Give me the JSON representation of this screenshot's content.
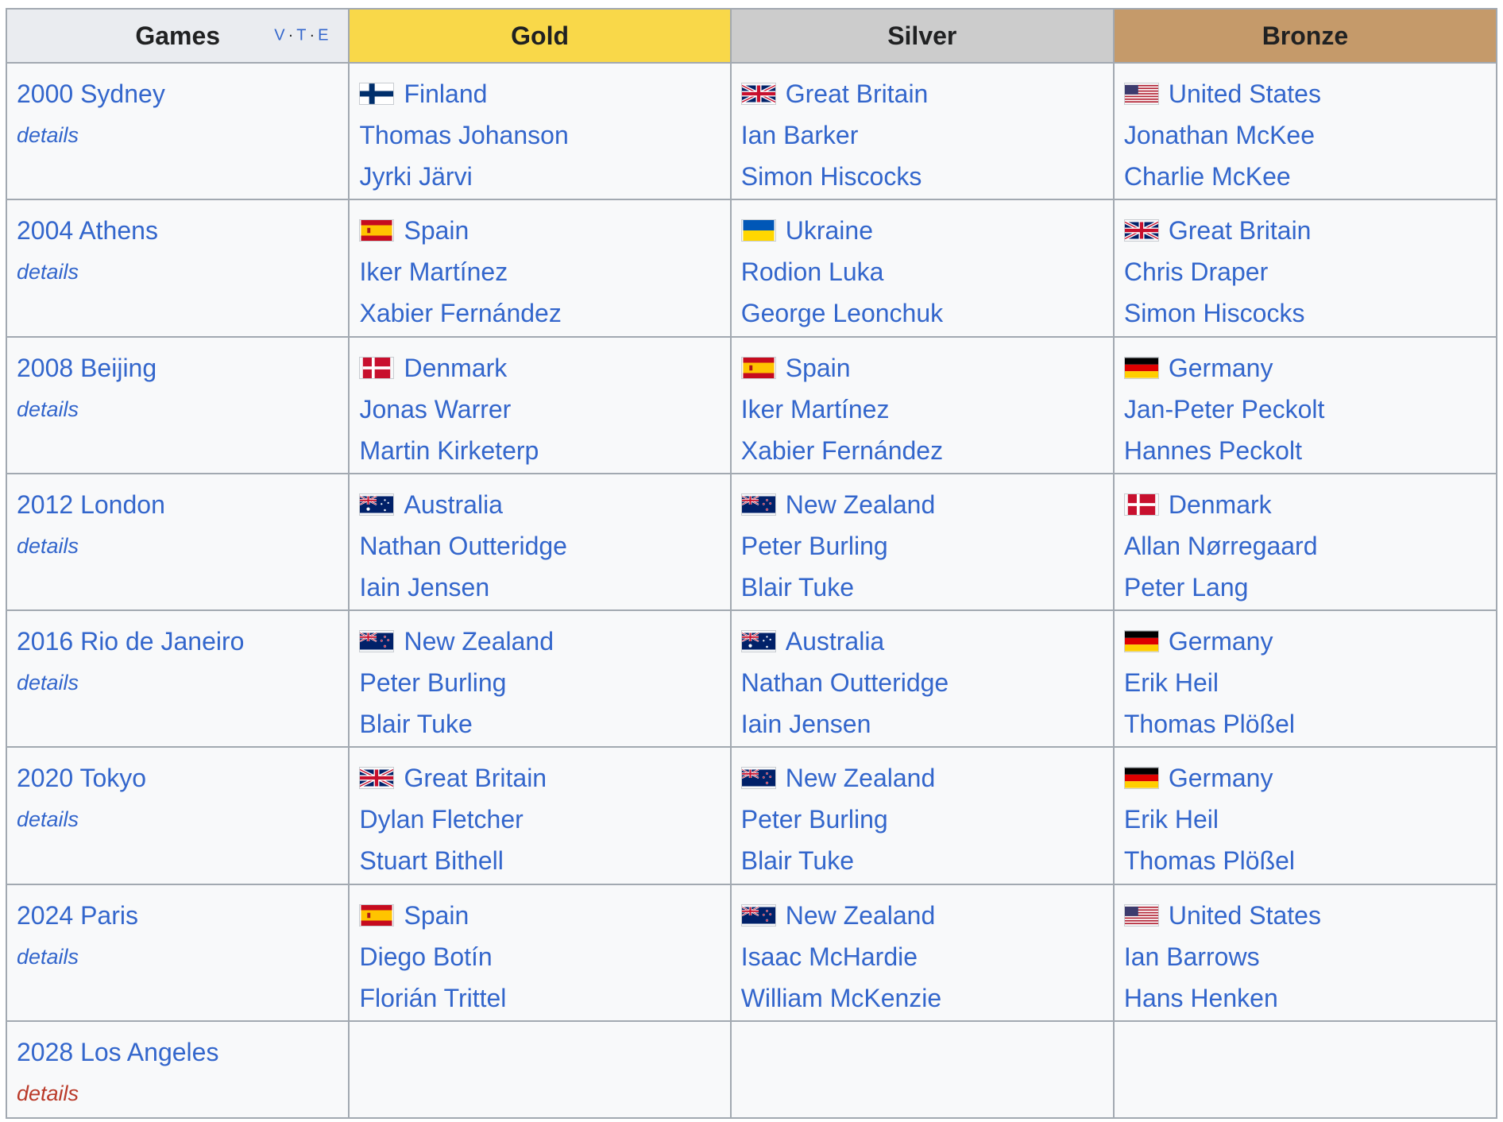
{
  "header": {
    "games": "Games",
    "gold": "Gold",
    "silver": "Silver",
    "bronze": "Bronze",
    "vte": [
      "V",
      "T",
      "E"
    ]
  },
  "colors": {
    "gold": "#f9d849",
    "silver": "#cccccc",
    "bronze": "#c59a6a",
    "link": "#3366cc",
    "redlink": "#ba3b2a"
  },
  "rows": [
    {
      "games": "2000 Sydney",
      "details": "details",
      "gold": {
        "flag": "finland-flag-icon",
        "country": "Finland",
        "athletes": [
          "Thomas Johanson",
          "Jyrki Järvi"
        ]
      },
      "silver": {
        "flag": "great-britain-flag-icon",
        "country": "Great Britain",
        "athletes": [
          "Ian Barker",
          "Simon Hiscocks"
        ]
      },
      "bronze": {
        "flag": "united-states-flag-icon",
        "country": "United States",
        "athletes": [
          "Jonathan McKee",
          "Charlie McKee"
        ]
      }
    },
    {
      "games": "2004 Athens",
      "details": "details",
      "gold": {
        "flag": "spain-flag-icon",
        "country": "Spain",
        "athletes": [
          "Iker Martínez",
          "Xabier Fernández"
        ]
      },
      "silver": {
        "flag": "ukraine-flag-icon",
        "country": "Ukraine",
        "athletes": [
          "Rodion Luka",
          "George Leonchuk"
        ]
      },
      "bronze": {
        "flag": "great-britain-flag-icon",
        "country": "Great Britain",
        "athletes": [
          "Chris Draper",
          "Simon Hiscocks"
        ]
      }
    },
    {
      "games": "2008 Beijing",
      "details": "details",
      "gold": {
        "flag": "denmark-flag-icon",
        "country": "Denmark",
        "athletes": [
          "Jonas Warrer",
          "Martin Kirketerp"
        ]
      },
      "silver": {
        "flag": "spain-flag-icon",
        "country": "Spain",
        "athletes": [
          "Iker Martínez",
          "Xabier Fernández"
        ]
      },
      "bronze": {
        "flag": "germany-flag-icon",
        "country": "Germany",
        "athletes": [
          "Jan-Peter Peckolt",
          "Hannes Peckolt"
        ]
      }
    },
    {
      "games": "2012 London",
      "details": "details",
      "gold": {
        "flag": "australia-flag-icon",
        "country": "Australia",
        "athletes": [
          "Nathan Outteridge",
          "Iain Jensen"
        ]
      },
      "silver": {
        "flag": "new-zealand-flag-icon",
        "country": "New Zealand",
        "athletes": [
          "Peter Burling",
          "Blair Tuke"
        ]
      },
      "bronze": {
        "flag": "denmark-flag-icon",
        "country": "Denmark",
        "athletes": [
          "Allan Nørregaard",
          "Peter Lang"
        ]
      }
    },
    {
      "games": "2016 Rio de Janeiro",
      "details": "details",
      "gold": {
        "flag": "new-zealand-flag-icon",
        "country": "New Zealand",
        "athletes": [
          "Peter Burling",
          "Blair Tuke"
        ]
      },
      "silver": {
        "flag": "australia-flag-icon",
        "country": "Australia",
        "athletes": [
          "Nathan Outteridge",
          "Iain Jensen"
        ]
      },
      "bronze": {
        "flag": "germany-flag-icon",
        "country": "Germany",
        "athletes": [
          "Erik Heil",
          "Thomas Plößel"
        ]
      }
    },
    {
      "games": "2020 Tokyo",
      "details": "details",
      "gold": {
        "flag": "great-britain-flag-icon",
        "country": "Great Britain",
        "athletes": [
          "Dylan Fletcher",
          "Stuart Bithell"
        ]
      },
      "silver": {
        "flag": "new-zealand-flag-icon",
        "country": "New Zealand",
        "athletes": [
          "Peter Burling",
          "Blair Tuke"
        ]
      },
      "bronze": {
        "flag": "germany-flag-icon",
        "country": "Germany",
        "athletes": [
          "Erik Heil",
          "Thomas Plößel"
        ]
      }
    },
    {
      "games": "2024 Paris",
      "details": "details",
      "gold": {
        "flag": "spain-flag-icon",
        "country": "Spain",
        "athletes": [
          "Diego Botín",
          "Florián Trittel"
        ]
      },
      "silver": {
        "flag": "new-zealand-flag-icon",
        "country": "New Zealand",
        "athletes": [
          "Isaac McHardie",
          "William McKenzie"
        ]
      },
      "bronze": {
        "flag": "united-states-flag-icon",
        "country": "United States",
        "athletes": [
          "Ian Barrows",
          "Hans Henken"
        ]
      }
    },
    {
      "games": "2028 Los Angeles",
      "details": "details",
      "details_redlink": true,
      "gold": null,
      "silver": null,
      "bronze": null
    }
  ]
}
